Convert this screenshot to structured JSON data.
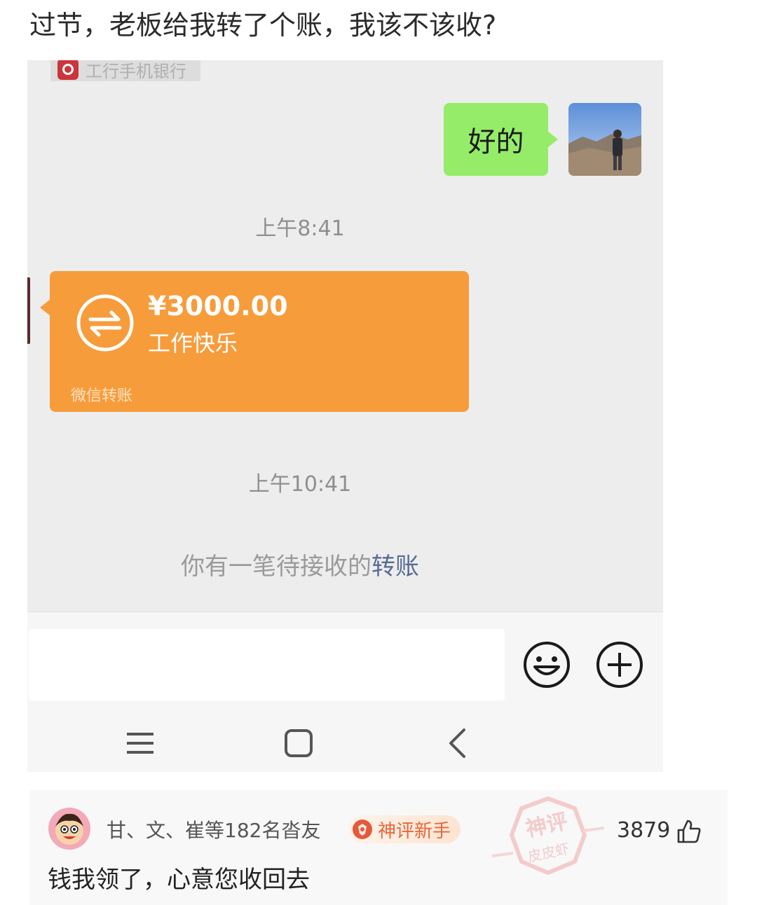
{
  "post": {
    "title": "过节，老板给我转了个账，我该不该收?"
  },
  "chat": {
    "app_chip_label": "工行手机银行",
    "outgoing_message": "好的",
    "time_first": "上午8:41",
    "transfer": {
      "amount": "¥3000.00",
      "note": "工作快乐",
      "source": "微信转账",
      "card_color": "#f79c3b"
    },
    "time_second": "上午10:41",
    "pending_prefix": "你有一笔待接收的",
    "pending_link": "转账",
    "input_placeholder": "",
    "icons": {
      "emoji": "smiley-icon",
      "plus": "plus-circle-icon"
    },
    "nav": {
      "menu": "menu-icon",
      "home": "home-square-icon",
      "back": "back-chevron-icon"
    }
  },
  "comment": {
    "author": "甘、文、崔等182名沓友",
    "badge": "神评新手",
    "likes": "3879",
    "text": "钱我领了，心意您收回去",
    "accent_color": "#e5663a",
    "stamp_text_top": "神评",
    "stamp_text_bottom": "皮皮虾"
  }
}
